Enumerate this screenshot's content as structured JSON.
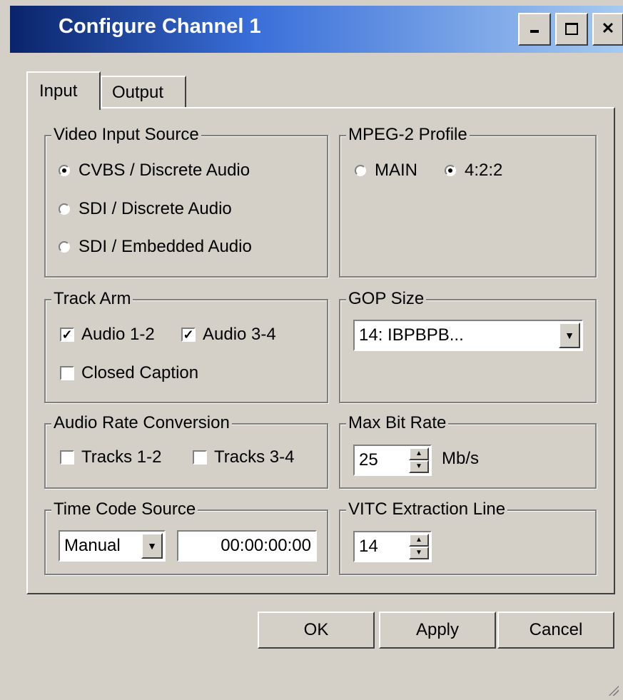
{
  "window": {
    "title": "Configure Channel 1",
    "minimize_icon": "minimize-icon",
    "maximize_icon": "maximize-icon",
    "close_icon": "close-icon"
  },
  "tabs": [
    {
      "label": "Input",
      "selected": true
    },
    {
      "label": "Output",
      "selected": false
    }
  ],
  "video_input_source": {
    "legend": "Video Input Source",
    "options": [
      {
        "label": "CVBS / Discrete Audio",
        "selected": true
      },
      {
        "label": "SDI / Discrete Audio",
        "selected": false
      },
      {
        "label": "SDI / Embedded Audio",
        "selected": false
      }
    ]
  },
  "mpeg2_profile": {
    "legend": "MPEG-2 Profile",
    "options": [
      {
        "label": "MAIN",
        "selected": false
      },
      {
        "label": "4:2:2",
        "selected": true
      }
    ]
  },
  "track_arm": {
    "legend": "Track Arm",
    "items": [
      {
        "label": "Audio 1-2",
        "checked": true
      },
      {
        "label": "Audio 3-4",
        "checked": true
      },
      {
        "label": "Closed Caption",
        "checked": false
      }
    ]
  },
  "gop_size": {
    "legend": "GOP Size",
    "value": "14: IBPBPB..."
  },
  "audio_rate_conversion": {
    "legend": "Audio Rate Conversion",
    "items": [
      {
        "label": "Tracks 1-2",
        "checked": false
      },
      {
        "label": "Tracks 3-4",
        "checked": false
      }
    ]
  },
  "max_bit_rate": {
    "legend": "Max Bit Rate",
    "value": "25",
    "unit": "Mb/s"
  },
  "time_code_source": {
    "legend": "Time Code Source",
    "mode": "Manual",
    "timecode": "00:00:00:00"
  },
  "vitc_extraction_line": {
    "legend": "VITC Extraction Line",
    "value": "14"
  },
  "buttons": {
    "ok": "OK",
    "apply": "Apply",
    "cancel": "Cancel"
  }
}
